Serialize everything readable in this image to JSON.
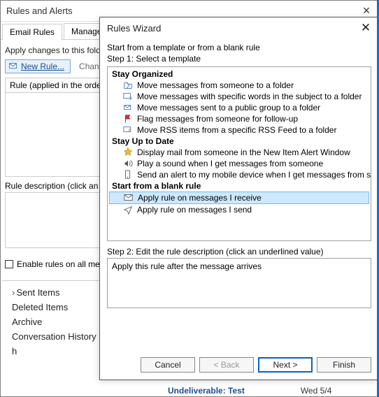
{
  "rules_dialog": {
    "title": "Rules and Alerts",
    "tabs": [
      "Email Rules",
      "Manage Alerts"
    ],
    "apply_label": "Apply changes to this folder",
    "new_rule_btn": "New Rule...",
    "change_rule_btn": "Change Ru",
    "grid_header": "Rule (applied in the orde",
    "desc_label": "Rule description (click an und",
    "enable_label": "Enable rules on all messa"
  },
  "folders": [
    {
      "label": "Sent Items",
      "chevron": true
    },
    {
      "label": "Deleted Items",
      "chevron": false
    },
    {
      "label": "Archive",
      "chevron": false
    },
    {
      "label": "Conversation History",
      "chevron": false
    },
    {
      "label": "h",
      "chevron": false
    }
  ],
  "wizard": {
    "title": "Rules Wizard",
    "instruction": "Start from a template or from a blank rule",
    "step1": "Step 1: Select a template",
    "groups": [
      {
        "title": "Stay Organized",
        "items": [
          {
            "icon": "move-folder",
            "label": "Move messages from someone to a folder"
          },
          {
            "icon": "move-subject",
            "label": "Move messages with specific words in the subject to a folder"
          },
          {
            "icon": "move-group",
            "label": "Move messages sent to a public group to a folder"
          },
          {
            "icon": "flag",
            "label": "Flag messages from someone for follow-up"
          },
          {
            "icon": "rss",
            "label": "Move RSS items from a specific RSS Feed to a folder"
          }
        ]
      },
      {
        "title": "Stay Up to Date",
        "items": [
          {
            "icon": "alert-star",
            "label": "Display mail from someone in the New Item Alert Window"
          },
          {
            "icon": "sound",
            "label": "Play a sound when I get messages from someone"
          },
          {
            "icon": "mobile",
            "label": "Send an alert to my mobile device when I get messages from someone"
          }
        ]
      },
      {
        "title": "Start from a blank rule",
        "items": [
          {
            "icon": "envelope",
            "label": "Apply rule on messages I receive",
            "selected": true
          },
          {
            "icon": "send",
            "label": "Apply rule on messages I send"
          }
        ]
      }
    ],
    "step2": "Step 2: Edit the rule description (click an underlined value)",
    "description": "Apply this rule after the message arrives",
    "buttons": {
      "cancel": "Cancel",
      "back": "< Back",
      "next": "Next >",
      "finish": "Finish"
    }
  },
  "mail_preview": {
    "subject": "Undeliverable: Test",
    "date": "Wed 5/4"
  }
}
